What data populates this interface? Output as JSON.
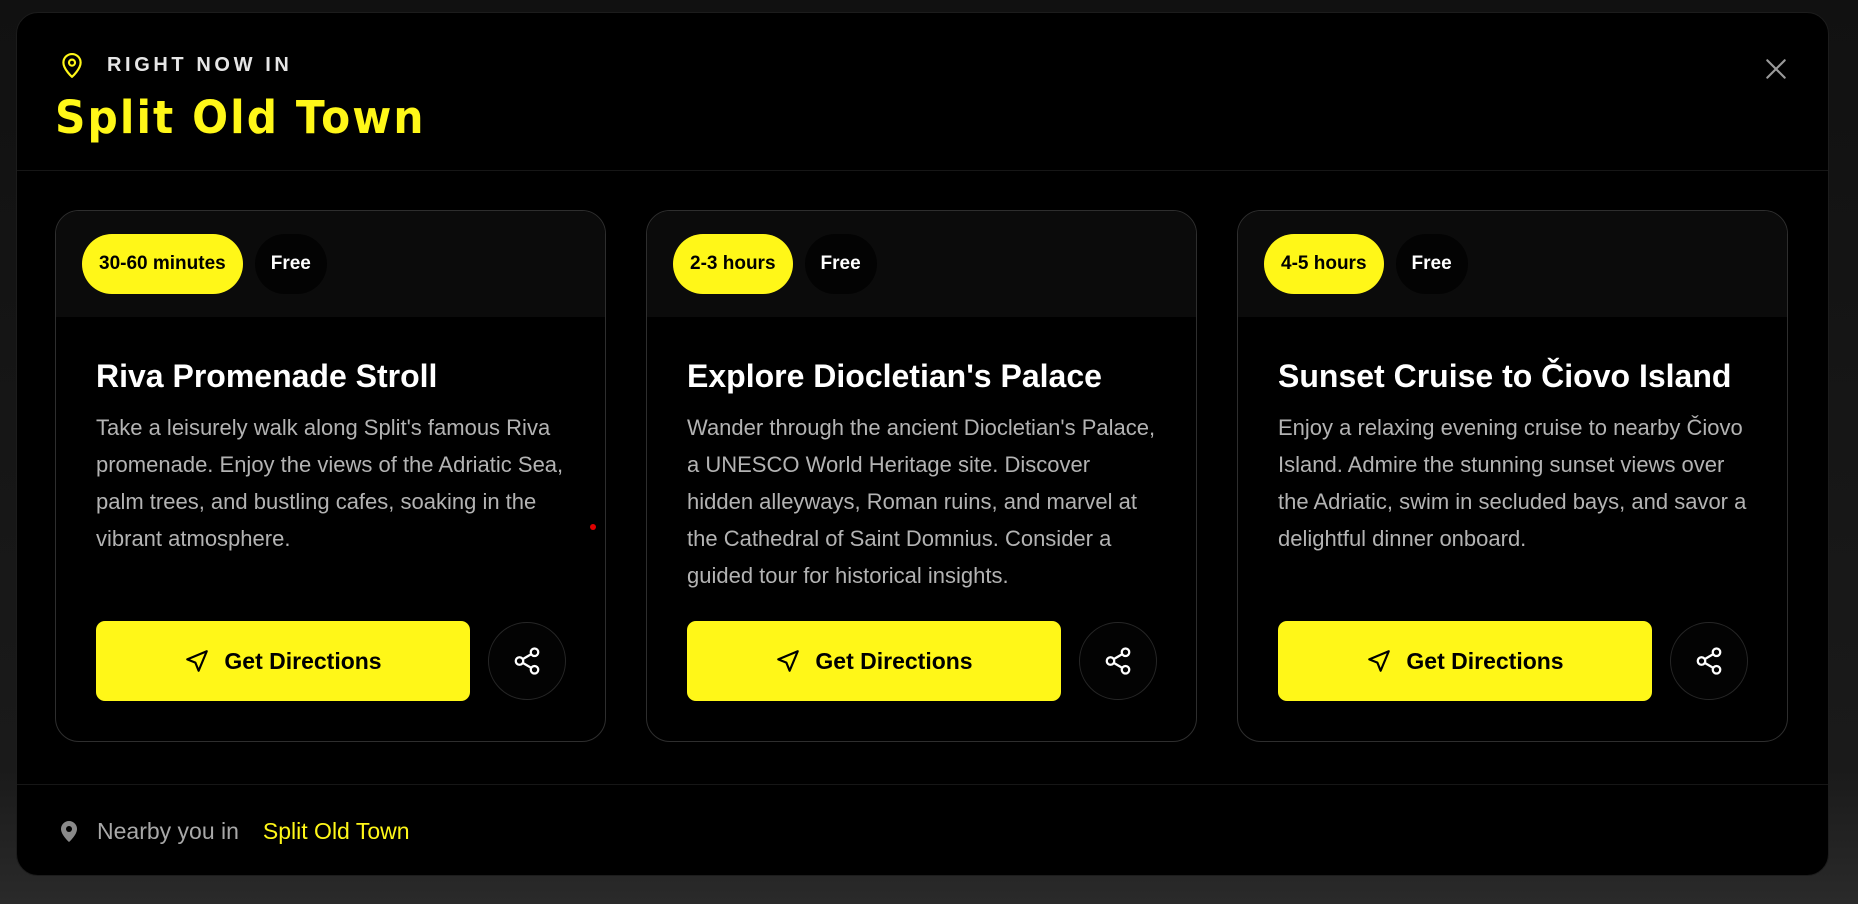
{
  "header": {
    "eyebrow": "RIGHT NOW IN",
    "title": "Split Old Town",
    "icons": {
      "location": "map-pin-icon",
      "close": "close-icon"
    }
  },
  "cards": [
    {
      "duration": "30-60 minutes",
      "price": "Free",
      "title": "Riva Promenade Stroll",
      "description": "Take a leisurely walk along Split's famous Riva promenade. Enjoy the views of the Adriatic Sea, palm trees, and bustling cafes, soaking in the vibrant atmosphere.",
      "directions_label": "Get Directions"
    },
    {
      "duration": "2-3 hours",
      "price": "Free",
      "title": "Explore Diocletian's Palace",
      "description": "Wander through the ancient Diocletian's Palace, a UNESCO World Heritage site. Discover hidden alleyways, Roman ruins, and marvel at the Cathedral of Saint Domnius. Consider a guided tour for historical insights.",
      "directions_label": "Get Directions"
    },
    {
      "duration": "4-5 hours",
      "price": "Free",
      "title": "Sunset Cruise to Čiovo Island",
      "description": "Enjoy a relaxing evening cruise to nearby Čiovo Island. Admire the stunning sunset views over the Adriatic, swim in secluded bays, and savor a delightful dinner onboard.",
      "directions_label": "Get Directions"
    }
  ],
  "footer": {
    "label": "Nearby you in",
    "place": "Split Old Town"
  },
  "colors": {
    "accent": "#fff718",
    "background": "#000000",
    "text_muted": "#b3b3b3"
  }
}
